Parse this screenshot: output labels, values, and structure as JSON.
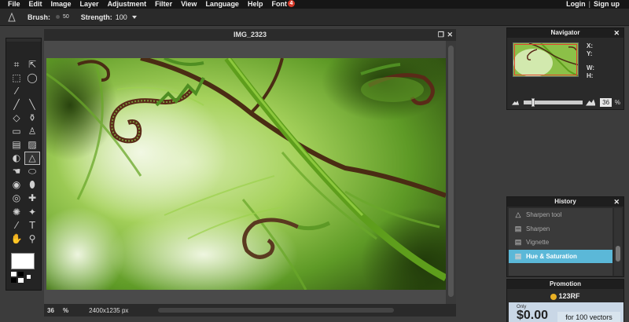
{
  "menubar": {
    "items": [
      "File",
      "Edit",
      "Image",
      "Layer",
      "Adjustment",
      "Filter",
      "View",
      "Language",
      "Help",
      "Font"
    ],
    "font_badge": "4",
    "login": "Login",
    "separator": "|",
    "signup": "Sign up"
  },
  "options": {
    "brush_label": "Brush:",
    "brush_size": "50",
    "strength_label": "Strength:",
    "strength_value": "100"
  },
  "tools": {
    "icons": [
      "crop-icon",
      "move-icon",
      "marquee-icon",
      "lasso-icon",
      "wand-icon",
      "",
      "pencil-icon",
      "brush-icon",
      "eraser-icon",
      "fill-icon",
      "gradient-icon",
      "stamp-icon",
      "color-replace-icon",
      "drawing-icon",
      "blur-icon",
      "sharpen-icon",
      "smudge-icon",
      "sponge-icon",
      "dodge-icon",
      "burn-icon",
      "red-eye-icon",
      "spot-heal-icon",
      "bloat-icon",
      "pinch-icon",
      "picker-icon",
      "type-icon",
      "hand-icon",
      "zoom-icon"
    ],
    "glyphs": [
      "⌗",
      "⇱",
      "⬚",
      "◯",
      "⁄",
      "",
      "╱",
      "╲",
      "◇",
      "⚱",
      "▭",
      "♙",
      "▤",
      "▨",
      "◐",
      "△",
      "☚",
      "⬭",
      "◉",
      "⬮",
      "◎",
      "✚",
      "✺",
      "✦",
      "⁄",
      "T",
      "✋",
      "⚲"
    ],
    "selected_index": 15,
    "fg_color": "#ffffff",
    "bg_color": "#000000"
  },
  "document": {
    "title": "IMG_2323",
    "zoom": "36",
    "zoom_unit": "%",
    "dimensions": "2400x1235 px"
  },
  "navigator": {
    "title": "Navigator",
    "x_label": "X:",
    "y_label": "Y:",
    "w_label": "W:",
    "h_label": "H:",
    "zoom": "36",
    "zoom_unit": "%",
    "zoom_fraction": 0.12
  },
  "history": {
    "title": "History",
    "items": [
      {
        "label": "Sharpen tool",
        "icon": "sharpen-tool-icon",
        "glyph": "△"
      },
      {
        "label": "Sharpen",
        "icon": "filter-icon",
        "glyph": "▤"
      },
      {
        "label": "Vignette",
        "icon": "filter-icon",
        "glyph": "▤"
      },
      {
        "label": "Hue & Saturation",
        "icon": "adjustment-icon",
        "glyph": "▤"
      }
    ],
    "active_index": 3
  },
  "promotion": {
    "title": "Promotion",
    "brand": "123RF",
    "only": "Only",
    "price": "$0.00",
    "offer": "for 100 vectors"
  },
  "colors": {
    "accent": "#5bb8d8",
    "badge": "#d83a2a",
    "menubar_bg": "#161616",
    "workspace_bg": "#3c3c3c"
  }
}
